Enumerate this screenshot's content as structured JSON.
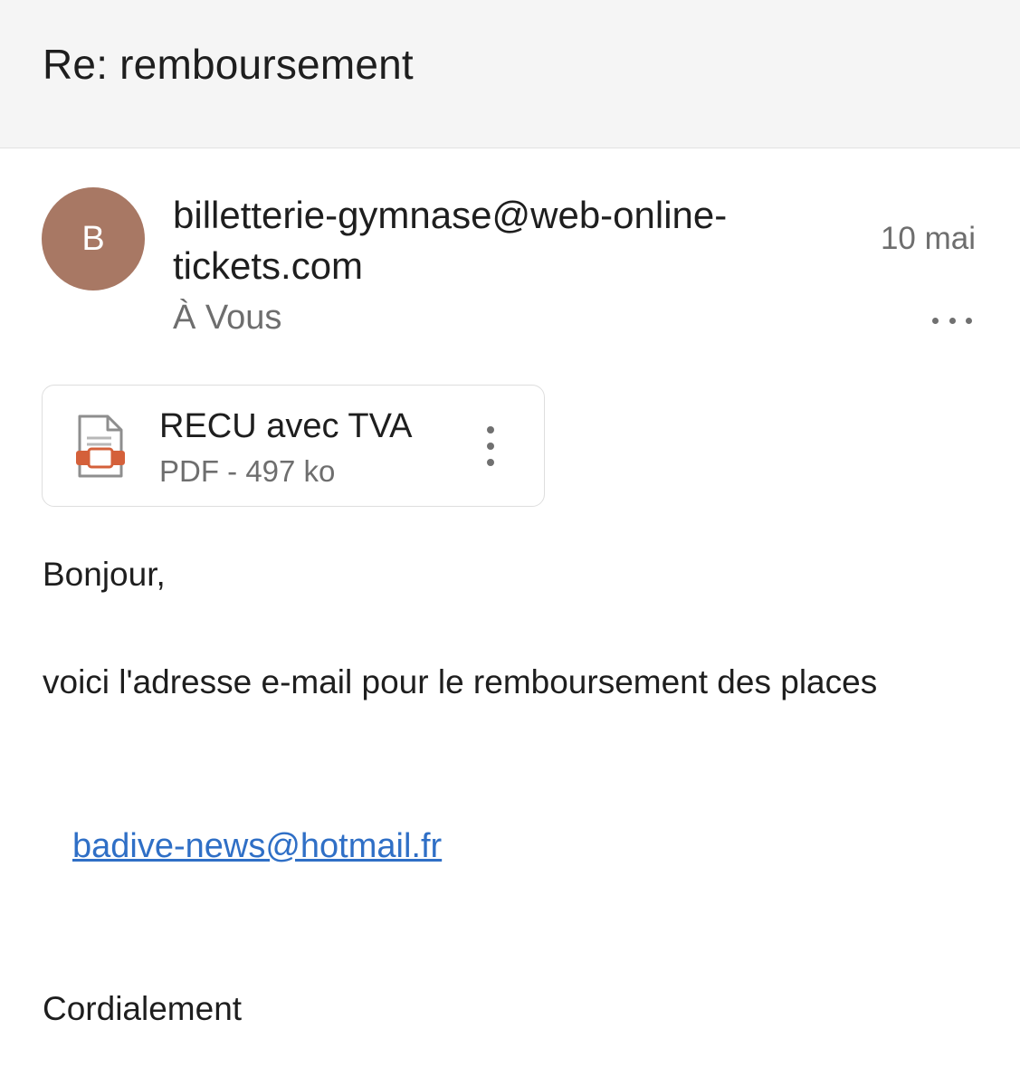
{
  "email": {
    "subject": "Re: remboursement",
    "avatar_initial": "B",
    "sender": "billetterie-gymnase@web-online-tickets.com",
    "date": "10 mai",
    "recipient": "À Vous",
    "more_icon": "more-horizontal-icon"
  },
  "attachment": {
    "name": "RECU avec TVA",
    "meta": "PDF - 497 ko",
    "icon": "pdf-file-icon",
    "menu_icon": "more-vertical-icon",
    "accent_color": "#d4603a"
  },
  "body": {
    "greeting": "Bonjour,",
    "message": "voici l'adresse e-mail pour le remboursement des places",
    "link": "badive-news@hotmail.fr",
    "closing": "Cordialement"
  },
  "colors": {
    "avatar": "#a87864",
    "link": "#2f6fc6",
    "header_bg": "#f5f5f5"
  }
}
